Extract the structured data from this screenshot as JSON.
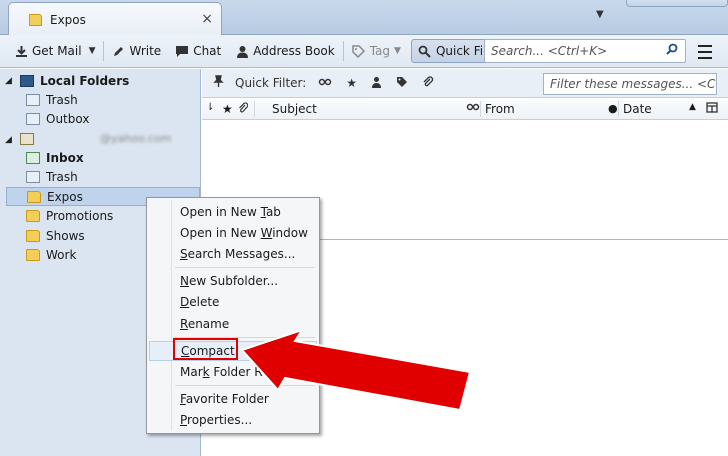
{
  "window": {
    "tab_title": "Expos",
    "close_glyph": "×",
    "tabs_menu_glyph": "▼"
  },
  "toolbar": {
    "get_mail": "Get Mail",
    "write": "Write",
    "chat": "Chat",
    "address_book": "Address Book",
    "tag": "Tag",
    "quick_filter": "Quick Filter",
    "search_placeholder": "Search... <Ctrl+K>"
  },
  "folders": {
    "local_folders": "Local Folders",
    "local_trash": "Trash",
    "local_outbox": "Outbox",
    "account_email": "@yahoo.com",
    "inbox": "Inbox",
    "trash": "Trash",
    "expos": "Expos",
    "promotions": "Promotions",
    "shows": "Shows",
    "work": "Work"
  },
  "quick_filter_bar": {
    "label": "Quick Filter:",
    "filter_placeholder": "Filter these messages... <Ctrl+Shift+K>"
  },
  "columns": {
    "subject": "Subject",
    "from": "From",
    "date": "Date"
  },
  "context_menu": {
    "items": [
      {
        "pre": "Open in New ",
        "key": "T",
        "post": "ab"
      },
      {
        "pre": "Open in New ",
        "key": "W",
        "post": "indow"
      },
      {
        "pre": "",
        "key": "S",
        "post": "earch Messages..."
      },
      {
        "pre": "",
        "key": "N",
        "post": "ew Subfolder..."
      },
      {
        "pre": "",
        "key": "D",
        "post": "elete"
      },
      {
        "pre": "",
        "key": "R",
        "post": "ename"
      },
      {
        "pre": "",
        "key": "C",
        "post": "ompact"
      },
      {
        "pre": "Mar",
        "key": "k",
        "post": " Folder Re"
      },
      {
        "pre": "",
        "key": "F",
        "post": "avorite Folder"
      },
      {
        "pre": "",
        "key": "P",
        "post": "roperties..."
      }
    ]
  },
  "colors": {
    "annotation_red": "#e00000",
    "folder_pane_bg": "#dbe5f1"
  }
}
